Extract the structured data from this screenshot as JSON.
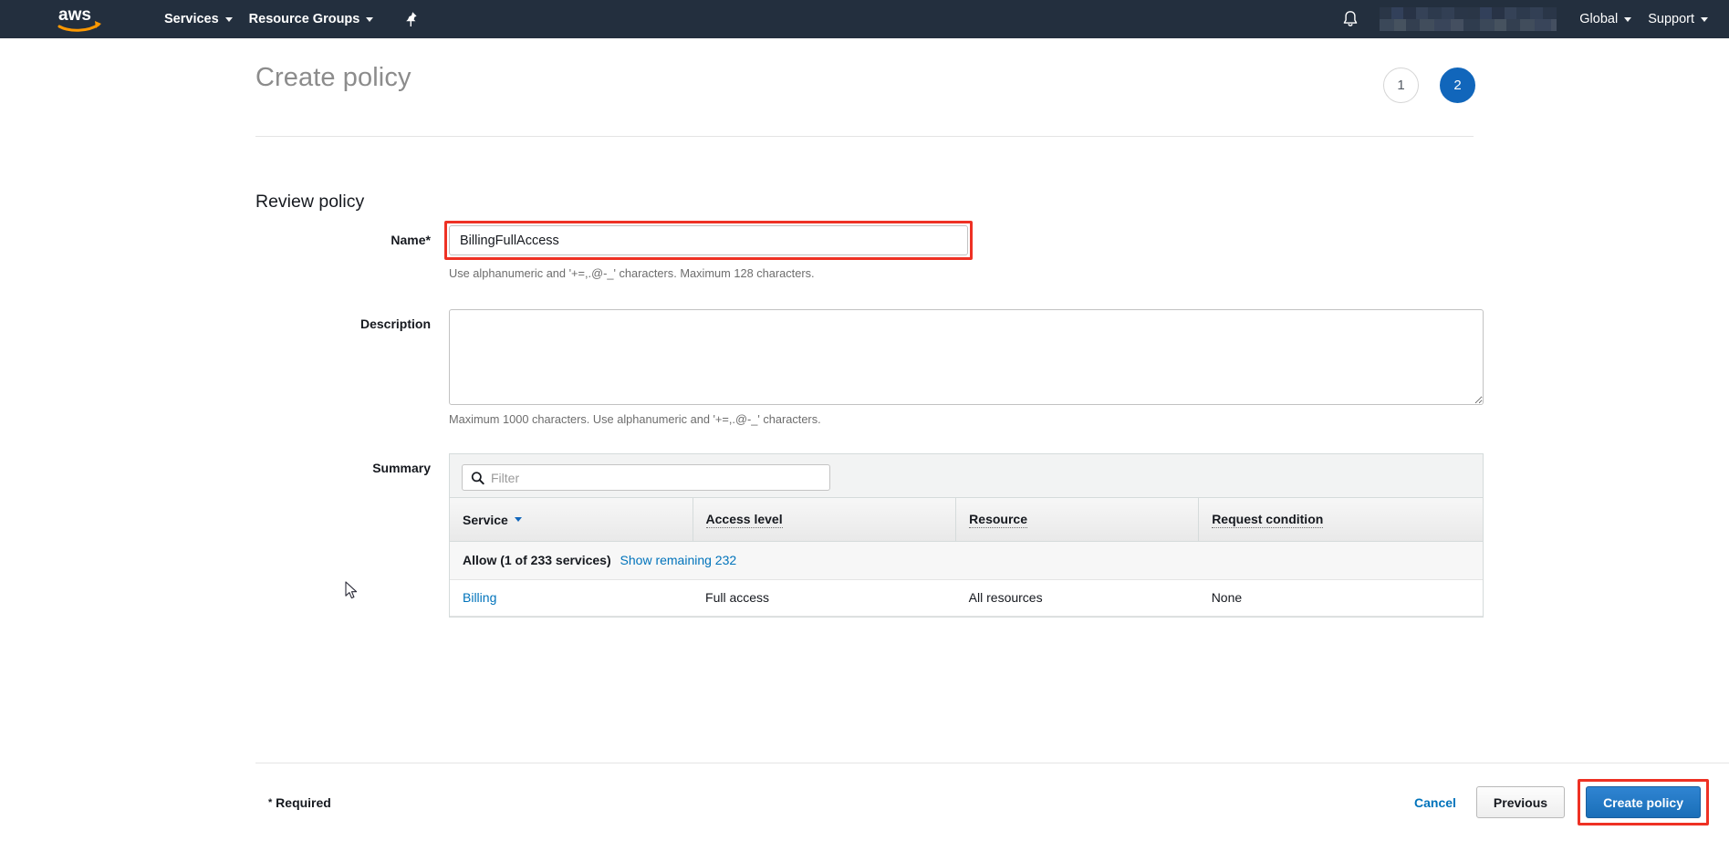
{
  "nav": {
    "logo_alt": "aws",
    "items": [
      {
        "label": "Services",
        "has_caret": true
      },
      {
        "label": "Resource Groups",
        "has_caret": true
      }
    ],
    "pin_icon": "pin-icon",
    "bell_icon": "notifications-bell-icon",
    "account_label": "",
    "right_items": [
      {
        "label": "Global",
        "has_caret": true
      },
      {
        "label": "Support",
        "has_caret": true
      }
    ]
  },
  "page": {
    "title": "Create policy",
    "steps": [
      {
        "number": "1",
        "state": "inactive"
      },
      {
        "number": "2",
        "state": "active"
      }
    ],
    "section_title": "Review policy"
  },
  "form": {
    "name": {
      "label": "Name*",
      "value": "BillingFullAccess",
      "placeholder": "",
      "hint": "Use alphanumeric and '+=,.@-_' characters. Maximum 128 characters.",
      "highlighted": true
    },
    "description": {
      "label": "Description",
      "value": "",
      "placeholder": "",
      "hint": "Maximum 1000 characters. Use alphanumeric and '+=,.@-_' characters."
    },
    "summary": {
      "label": "Summary",
      "filter_placeholder": "Filter",
      "filter_value": "",
      "filter_icon": "search-icon",
      "columns": [
        {
          "label": "Service",
          "sortable": true,
          "tooltip": false
        },
        {
          "label": "Access level",
          "sortable": false,
          "tooltip": true
        },
        {
          "label": "Resource",
          "sortable": false,
          "tooltip": true
        },
        {
          "label": "Request condition",
          "sortable": false,
          "tooltip": true
        }
      ],
      "group_row": {
        "prefix": "Allow (1 of 233 services)",
        "link_text": "Show remaining 232"
      },
      "rows": [
        {
          "service": "Billing",
          "service_is_link": true,
          "access_level": "Full access",
          "resource": "All resources",
          "request_condition": "None"
        }
      ]
    }
  },
  "footer": {
    "required_star": "*",
    "required_text": "Required",
    "cancel_label": "Cancel",
    "previous_label": "Previous",
    "create_label": "Create policy",
    "create_highlighted": true
  },
  "colors": {
    "nav_bg": "#232f3e",
    "accent_blue": "#0073bb",
    "primary_button": "#1a6fb8",
    "highlight_red": "#ee3124",
    "aws_orange": "#ff9900"
  }
}
